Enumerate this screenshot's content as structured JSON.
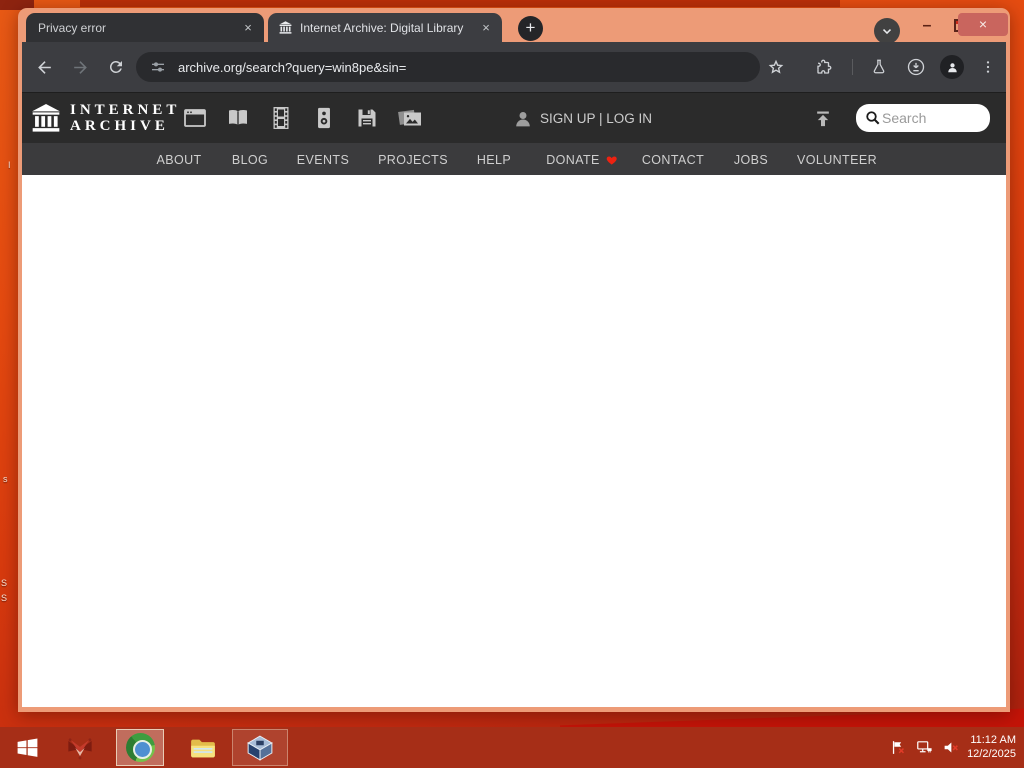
{
  "colors": {
    "frame_salmon": "#ED9B77",
    "desktop_orange": "#E34E12",
    "taskbar_red": "#A62E17",
    "close_button_red": "#C9655E",
    "toolbar_dark": "#3C3D41",
    "site_header_dark": "#2B2B2B",
    "site_nav_dark": "#3B3B3D",
    "donate_heart_red": "#EE2211"
  },
  "browser": {
    "tabs": [
      {
        "title": "Privacy error"
      },
      {
        "title": "Internet Archive: Digital Library"
      }
    ],
    "close_glyph": "×",
    "new_tab_glyph": "+",
    "minimize_glyph": "–",
    "url": "archive.org/search?query=win8pe&sin="
  },
  "archive": {
    "logo_line1": "INTERNET",
    "logo_line2": "ARCHIVE",
    "media_icons": [
      "web",
      "texts",
      "video",
      "audio",
      "software",
      "images"
    ],
    "signup_login": "SIGN UP | LOG IN",
    "search_placeholder": "Search",
    "nav": [
      "ABOUT",
      "BLOG",
      "EVENTS",
      "PROJECTS",
      "HELP",
      "DONATE",
      "CONTACT",
      "JOBS",
      "VOLUNTEER"
    ]
  },
  "taskbar": {
    "time": "11:12 AM",
    "date": "12/2/2025"
  },
  "desktop": {
    "icon_label_fragments": [
      "I",
      "s",
      "S",
      "S"
    ]
  }
}
